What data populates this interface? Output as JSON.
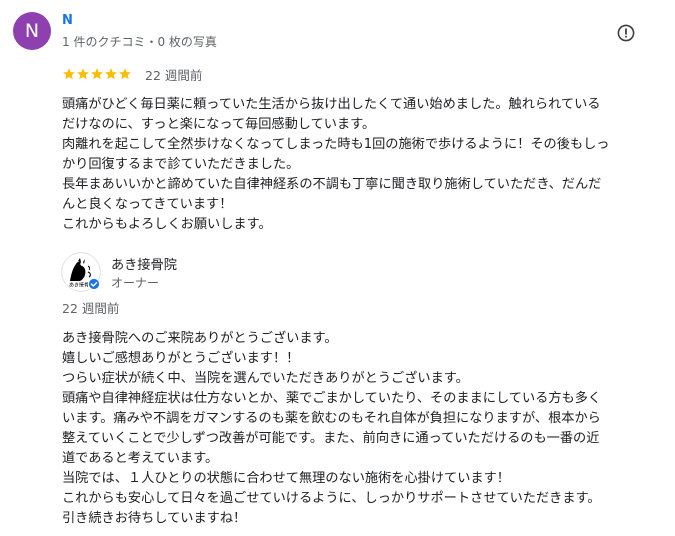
{
  "review": {
    "avatar_letter": "N",
    "reviewer_name": "N",
    "reviewer_meta": "1 件のクチコミ・0 枚の写真",
    "rating": 5,
    "time": "22 週間前",
    "text_lines": [
      "頭痛がひどく毎日薬に頼っていた生活から抜け出したくて通い始めました。触れられている",
      "だけなのに、すっと楽になって毎回感動しています。",
      "肉離れを起こして全然歩けなくなってしまった時も1回の施術で歩けるように！その後もしっ",
      "かり回復するまで診ていただきました。",
      "長年まあいいかと諦めていた自律神経系の不調も丁寧に聞き取り施術していただき、だんだ",
      "んと良くなってきています！",
      "これからもよろしくお願いします。"
    ]
  },
  "colors": {
    "avatar_bg": "#8e3fb0",
    "star": "#fbbc04",
    "name_link": "#1a73e8",
    "verified_badge": "#1a73e8"
  },
  "icons": {
    "more": "exclamation-circle-icon",
    "star": "star-icon",
    "verified": "verified-check-icon"
  },
  "owner_reply": {
    "logo_text": "あき接骨院",
    "owner_name": "あき接骨院",
    "owner_role": "オーナー",
    "time": "22 週間前",
    "text_lines": [
      "あき接骨院へのご来院ありがとうございます。",
      "嬉しいご感想ありがとうございます！！",
      "つらい症状が続く中、当院を選んでいただきありがとうございます。",
      "頭痛や自律神経症状は仕方ないとか、薬でごまかしていたり、そのままにしている方も多く",
      "います。痛みや不調をガマンするのも薬を飲むのもそれ自体が負担になりますが、根本から",
      "整えていくことで少しずつ改善が可能です。また、前向きに通っていただけるのも一番の近",
      "道であると考えています。",
      "当院では、１人ひとりの状態に合わせて無理のない施術を心掛けています！",
      "これからも安心して日々を過ごせていけるように、しっかりサポートさせていただきます。",
      "引き続きお待ちしていますね！"
    ]
  }
}
